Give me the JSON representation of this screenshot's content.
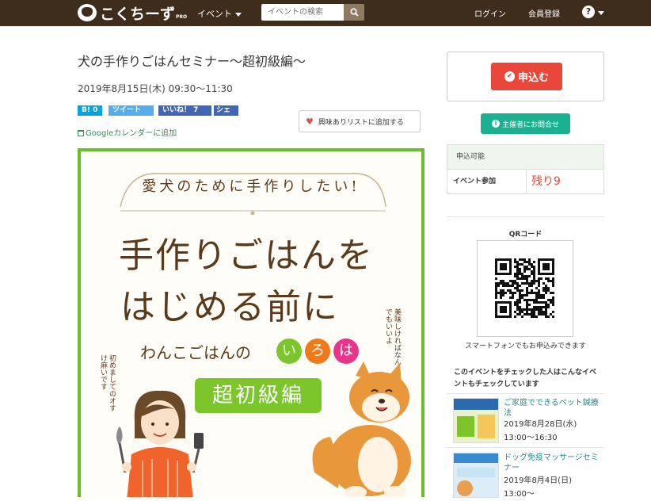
{
  "header": {
    "logo_text": "こくちーず",
    "logo_sub": "PRO",
    "event_menu": "イベント",
    "search_placeholder": "イベントの検索",
    "login": "ログイン",
    "register": "会員登録",
    "help": "?"
  },
  "event": {
    "title": "犬の手作りごはんセミナー〜超初級編〜",
    "datetime": "2019年8月15日(木) 09:30〜11:30",
    "share": {
      "hatena": "B! 0",
      "tweet": "ツイート",
      "like": "いいね！ 7",
      "share": "シェア"
    },
    "gcal": "Googleカレンダーに追加",
    "wishlist": "興味ありリストに追加する"
  },
  "flyer": {
    "headline_small": "愛犬のために手作りしたい!",
    "headline_1": "手作りごはんを",
    "headline_2": "はじめる前に",
    "sub": "わんこごはんの",
    "iroha": [
      "い",
      "ろ",
      "は"
    ],
    "badge": "超初級編",
    "side_note_left": "初めましてのオすけ麻いです",
    "side_note_right": "美味しければなんでもいいよ"
  },
  "sidebar": {
    "apply_label": "申込む",
    "contact_label": "主催者にお問合せ",
    "status_head": "申込可能",
    "status_row_label": "イベント参加",
    "status_row_value": "残り9",
    "qr_label": "QRコード",
    "qr_caption": "スマートフォンでもお申込みできます",
    "recommend_heading": "このイベントをチェックした人はこんなイベントもチェックしています",
    "recommend": [
      {
        "title": "ご家庭でできるペット鍼療法",
        "date": "2019年8月28日(水) 13:00〜16:30"
      },
      {
        "title": "ドッグ免疫マッサージセミナー",
        "date": "2019年8月4日(日) 13:00〜"
      }
    ]
  },
  "colors": {
    "header_bg": "#3e2d1c",
    "apply": "#e8473a",
    "contact": "#1ab090",
    "flyer_border": "#6cbf2c"
  }
}
